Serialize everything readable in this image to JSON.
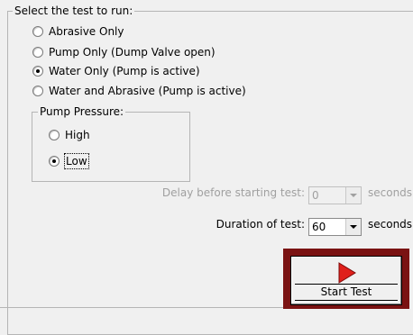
{
  "test_group": {
    "legend": "Select the test to run:",
    "options": [
      {
        "label": "Abrasive Only",
        "checked": false
      },
      {
        "label": "Pump Only (Dump Valve open)",
        "checked": false
      },
      {
        "label": "Water Only (Pump is active)",
        "checked": true
      },
      {
        "label": "Water and Abrasive (Pump is active)",
        "checked": false
      }
    ]
  },
  "pressure_group": {
    "legend": "Pump Pressure:",
    "options": [
      {
        "label": "High",
        "checked": false
      },
      {
        "label": "Low",
        "checked": true
      }
    ]
  },
  "delay": {
    "label": "Delay before starting test:",
    "value": "0",
    "unit": "seconds",
    "enabled": false
  },
  "duration": {
    "label": "Duration of test:",
    "value": "60",
    "unit": "seconds",
    "enabled": true
  },
  "start_button": {
    "label": "Start Test",
    "icon": "play-icon",
    "color": "#e0201b",
    "frame_color": "#7a1212"
  }
}
